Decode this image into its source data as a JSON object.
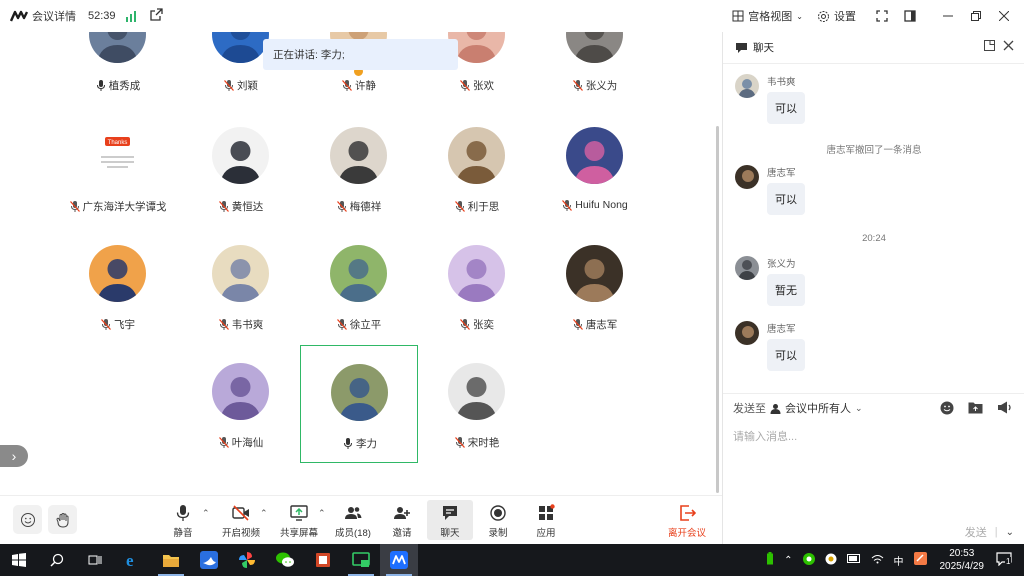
{
  "titlebar": {
    "app_title": "会议详情",
    "elapsed": "52:39",
    "view_label": "宫格视图",
    "settings_label": "设置"
  },
  "speaking_banner": "正在讲话: 李力;",
  "participants": [
    {
      "name": "植秀成",
      "mic": "on"
    },
    {
      "name": "刘颖",
      "mic": "muted"
    },
    {
      "name": "许静",
      "mic": "muted"
    },
    {
      "name": "张欢",
      "mic": "muted"
    },
    {
      "name": "张义为",
      "mic": "muted"
    },
    {
      "name": "广东海洋大学谭戈",
      "mic": "muted"
    },
    {
      "name": "黄恒达",
      "mic": "muted"
    },
    {
      "name": "梅德祥",
      "mic": "muted"
    },
    {
      "name": "利于思",
      "mic": "muted"
    },
    {
      "name": "Huifu Nong",
      "mic": "muted"
    },
    {
      "name": "飞宇",
      "mic": "muted"
    },
    {
      "name": "韦书爽",
      "mic": "muted"
    },
    {
      "name": "徐立平",
      "mic": "muted"
    },
    {
      "name": "张奕",
      "mic": "muted"
    },
    {
      "name": "唐志军",
      "mic": "muted"
    },
    {
      "name": "叶海仙",
      "mic": "muted"
    },
    {
      "name": "李力",
      "mic": "on"
    },
    {
      "name": "宋时艳",
      "mic": "muted"
    }
  ],
  "avatar_badge_text": "Thanks",
  "toolbar": {
    "mute": "静音",
    "video": "开启视频",
    "share": "共享屏幕",
    "members": "成员(18)",
    "invite": "邀请",
    "chat": "聊天",
    "record": "录制",
    "apps": "应用",
    "leave": "离开会议"
  },
  "chat": {
    "title": "聊天",
    "messages": [
      {
        "sender": "韦书爽",
        "text": "可以"
      },
      {
        "system": "唐志军撤回了一条消息"
      },
      {
        "sender": "唐志军",
        "text": "可以"
      },
      {
        "time": "20:24"
      },
      {
        "sender": "张义为",
        "text": "暂无"
      },
      {
        "sender": "唐志军",
        "text": "可以"
      }
    ],
    "send_to_label": "发送至",
    "send_to_target": "会议中所有人",
    "input_placeholder": "请输入消息...",
    "send_label": "发送"
  },
  "taskbar": {
    "time": "20:53",
    "date": "2025/4/29",
    "ime": "中",
    "notification_count": "1"
  },
  "colors": {
    "accent": "#2fb866",
    "leave": "#e8401c",
    "banner": "#e8f0fd"
  }
}
